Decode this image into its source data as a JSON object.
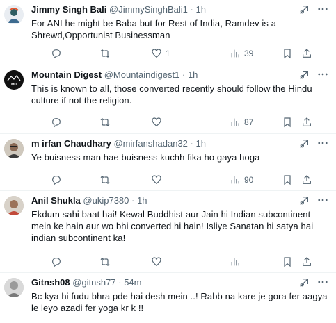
{
  "tweets": [
    {
      "name": "Jimmy Singh Bali",
      "handle": "@JimmySinghBali1",
      "dot": "·",
      "time": "1h",
      "text": "For ANI he might be Baba but for Rest of India, Ramdev is a Shrewd,Opportunist Businessman",
      "replies": "",
      "retweets": "",
      "likes": "1",
      "views": "39",
      "avatar_color": "#e9edf2"
    },
    {
      "name": "Mountain Digest",
      "handle": "@Mountaindigest1",
      "dot": "·",
      "time": "1h",
      "text": "This is known to all, those converted recently should follow the Hindu culture if not the religion.",
      "replies": "",
      "retweets": "",
      "likes": "",
      "views": "87",
      "avatar_logo_text": "MOUNTAIN DIGEST",
      "avatar_logo_initials": "MD",
      "avatar_color": "#111111"
    },
    {
      "name": "m irfan Chaudhary",
      "handle": "@mirfanshadan32",
      "dot": "·",
      "time": "1h",
      "text": "Ye buisness man hae buisness kuchh fika ho gaya hoga",
      "replies": "",
      "retweets": "",
      "likes": "",
      "views": "90",
      "avatar_color": "#b8b0a6"
    },
    {
      "name": "Anil Shukla",
      "handle": "@ukip7380",
      "dot": "·",
      "time": "1h",
      "text": "Ekdum sahi baat hai! Kewal Buddhist aur Jain hi Indian subcontinent mein ke hain aur wo bhi converted hi hain! Isliye Sanatan hi satya hai indian subcontinent ka!",
      "replies": "",
      "retweets": "",
      "likes": "",
      "views": "",
      "avatar_color": "#c9c3bb"
    },
    {
      "name": "Gitnsh08",
      "handle": "@gitnsh77",
      "dot": "·",
      "time": "54m",
      "text": "Bc kya hi fudu bhra pde hai desh mein ..! Rabb na kare je gora fer aagya le leyo azadi fer yoga kr k !!",
      "replies": "",
      "retweets": "",
      "likes": "",
      "views": "",
      "avatar_color": "#d6d6d6"
    }
  ],
  "colors": {
    "secondary_text": "#536471",
    "primary_text": "#0f1419",
    "divider": "#eff3f4"
  },
  "icons": [
    "reply-icon",
    "retweet-icon",
    "like-icon",
    "views-icon",
    "bookmark-icon",
    "share-icon",
    "grok-icon",
    "more-icon"
  ]
}
